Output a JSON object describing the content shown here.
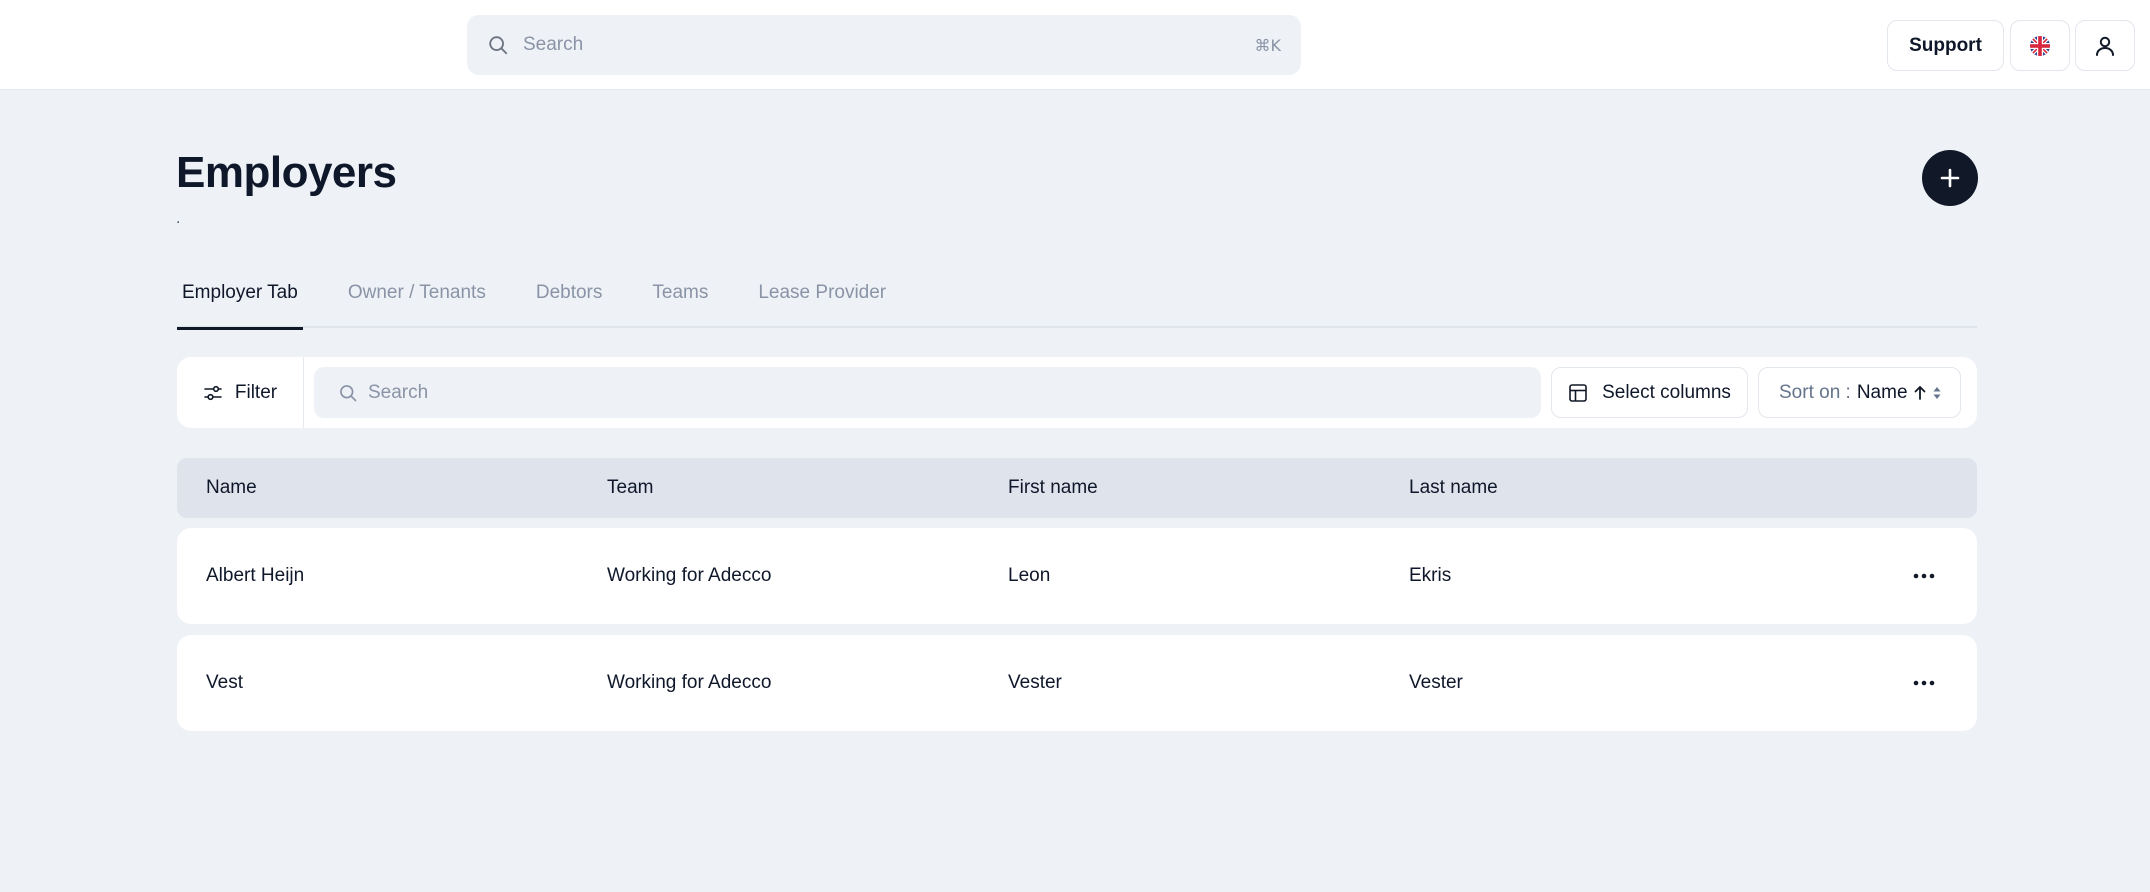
{
  "topbar": {
    "search_placeholder": "Search",
    "search_shortcut": "⌘K",
    "support_label": "Support",
    "language_icon": "uk-flag-icon",
    "user_icon": "user-icon"
  },
  "header": {
    "title": "Employers",
    "subtitle": ".",
    "add_icon": "plus-icon"
  },
  "tabs": [
    {
      "label": "Employer Tab",
      "active": true
    },
    {
      "label": "Owner / Tenants",
      "active": false
    },
    {
      "label": "Debtors",
      "active": false
    },
    {
      "label": "Teams",
      "active": false
    },
    {
      "label": "Lease Provider",
      "active": false
    }
  ],
  "toolbar": {
    "filter_label": "Filter",
    "search_placeholder": "Search",
    "select_columns_label": "Select columns",
    "sort_prefix": "Sort on :",
    "sort_value": "Name"
  },
  "table": {
    "columns": [
      "Name",
      "Team",
      "First name",
      "Last name"
    ],
    "rows": [
      [
        "Albert Heijn",
        "Working for Adecco",
        "Leon",
        "Ekris"
      ],
      [
        "Vest",
        "Working for Adecco",
        "Vester",
        "Vester"
      ]
    ]
  },
  "colors": {
    "page_bg": "#eef2f7",
    "accent_dark": "#111827",
    "header_row_bg": "#dee3ec"
  }
}
